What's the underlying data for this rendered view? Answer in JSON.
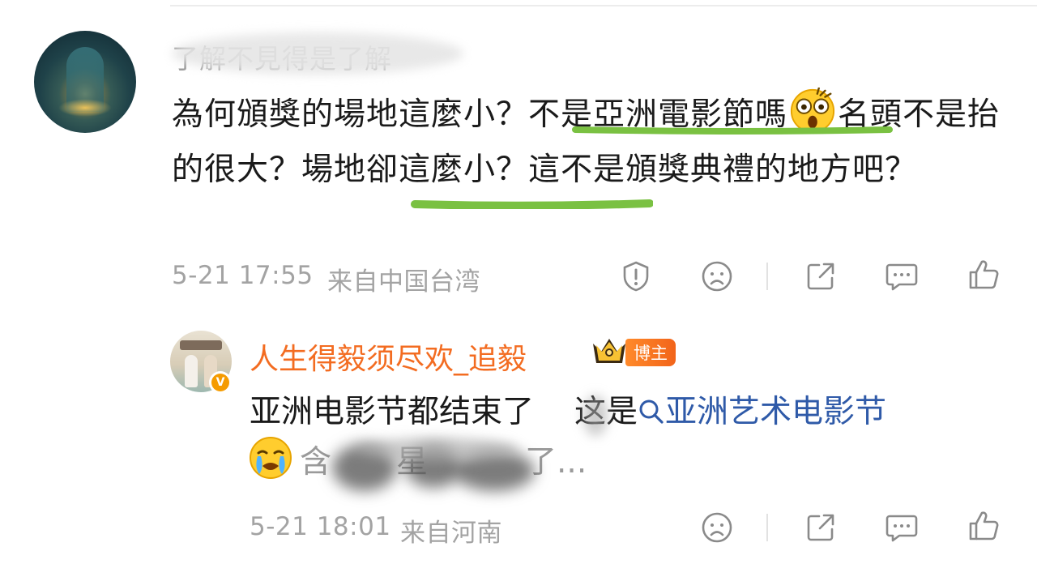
{
  "comment": {
    "username": "了解不見得是了解",
    "body_part1": "為何頒獎的場地這麼小？",
    "body_highlight1": "不是亞洲電影節嗎",
    "body_part2": "名頭不是抬的很大？",
    "body_highlight2": "場地卻這麼小？",
    "body_part3": "這不是頒獎典禮的地方吧？",
    "timestamp": "5-21 17:55",
    "source": "来自中国台湾",
    "emoji": "shocked-face"
  },
  "reply": {
    "username": "人生得毅须尽欢_追毅",
    "role_badge": "博主",
    "verified_mark": "V",
    "body_part1": "亚洲电影节都结束了",
    "body_part2": "这是",
    "topic_link": "亚洲艺术电影节",
    "line2_text": "含",
    "line2_text_b": "星",
    "line2_tail": "了...",
    "emoji": "crying-face",
    "timestamp": "5-21 18:01",
    "source": "来自河南"
  },
  "colors": {
    "username_reply": "#f36c21",
    "badge": "#f2641a",
    "link": "#2f5aa8",
    "underline": "#7ac142",
    "meta": "#a3a3a3"
  },
  "icons": [
    "report-icon",
    "dislike-icon",
    "share-icon",
    "comment-icon",
    "like-icon",
    "crown-icon",
    "search-icon"
  ]
}
